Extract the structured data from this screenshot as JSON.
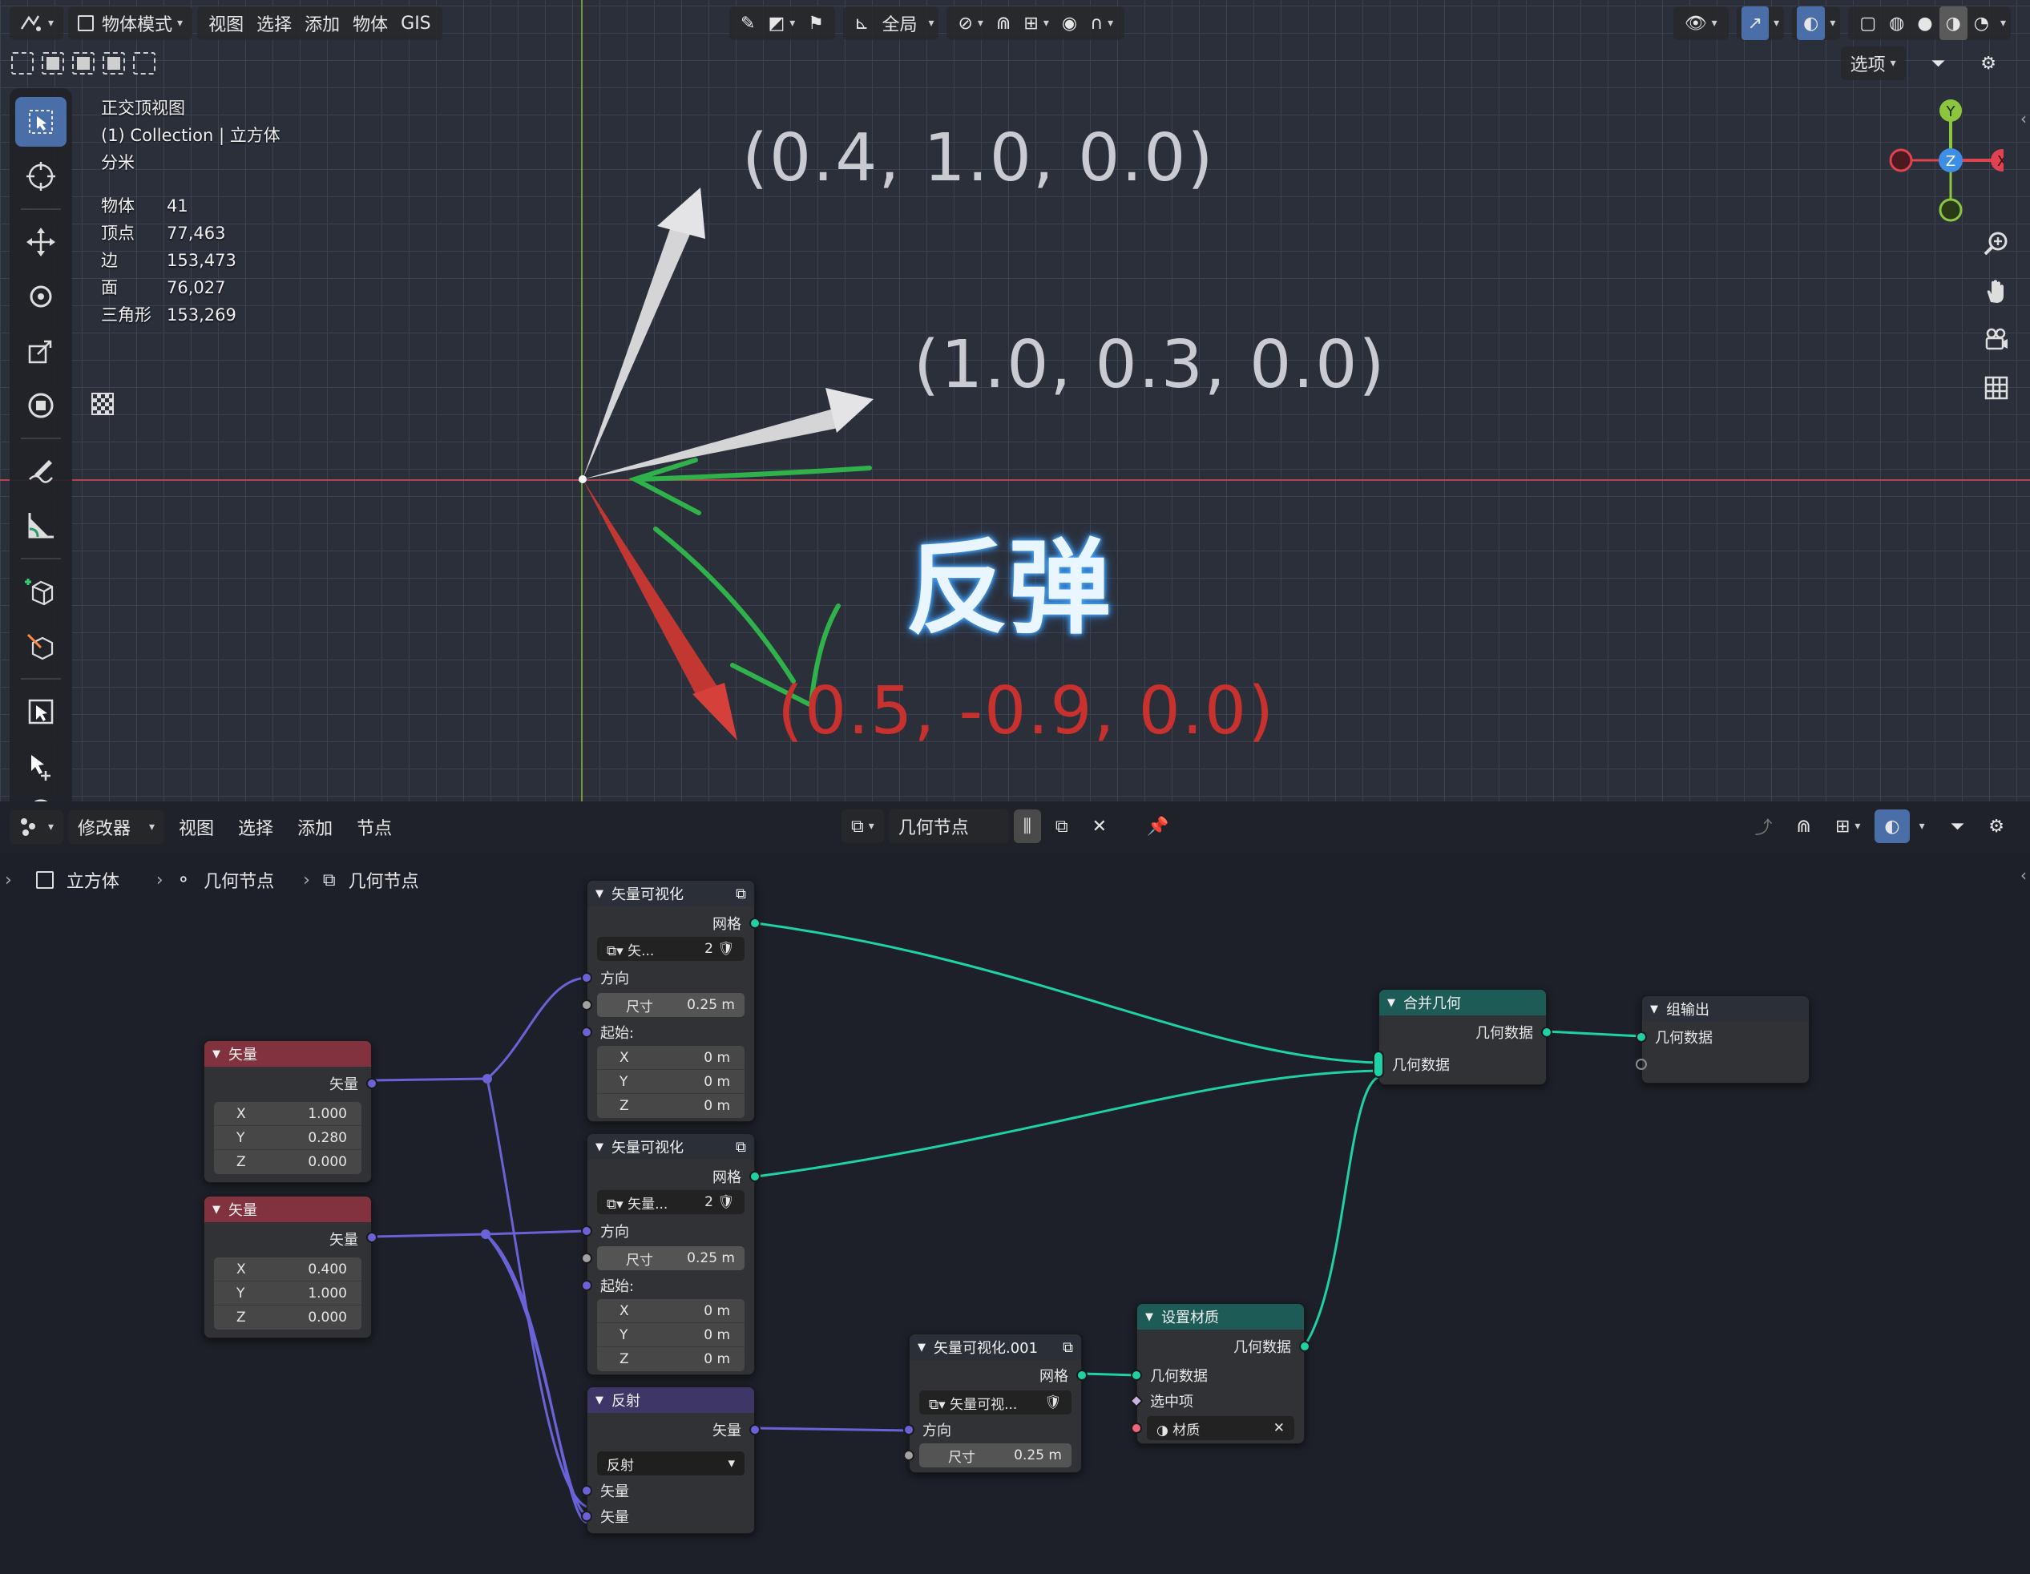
{
  "viewport": {
    "header": {
      "mode_label": "物体模式",
      "menus": [
        "视图",
        "选择",
        "添加",
        "物体",
        "GIS"
      ],
      "transform_orientation": "全局",
      "options_label": "选项"
    },
    "overlay": {
      "view_name": "正交顶视图",
      "collection_line": "(1) Collection | 立方体",
      "unit": "分米",
      "stats": [
        {
          "label": "物体",
          "value": "41"
        },
        {
          "label": "顶点",
          "value": "77,463"
        },
        {
          "label": "边",
          "value": "153,473"
        },
        {
          "label": "面",
          "value": "76,027"
        },
        {
          "label": "三角形",
          "value": "153,269"
        }
      ]
    },
    "gizmo": {
      "y": "Y",
      "x": "X",
      "z": "Z"
    },
    "annotations": {
      "vector_a": "(0.4, 1.0, 0.0)",
      "vector_b": "(1.0, 0.3, 0.0)",
      "vector_reflected": "(0.5, -0.9, 0.0)",
      "bounce": "反弹"
    },
    "colors": {
      "grid_bg": "#2b2f3a",
      "x_axis": "#b24650",
      "y_axis": "#6e9a3a",
      "reflect": "#c8312e",
      "annotation_green": "#2fb24a"
    }
  },
  "node_editor": {
    "header": {
      "editor_type": "修改器",
      "menus": [
        "视图",
        "选择",
        "添加",
        "节点"
      ],
      "tree_name": "几何节点"
    },
    "breadcrumb": [
      "立方体",
      "几何节点",
      "几何节点"
    ],
    "nodes": {
      "vector1": {
        "title": "矢量",
        "output": "矢量",
        "x": "1.000",
        "y": "0.280",
        "z": "0.000",
        "lx": "X",
        "ly": "Y",
        "lz": "Z"
      },
      "vector2": {
        "title": "矢量",
        "output": "矢量",
        "x": "0.400",
        "y": "1.000",
        "z": "0.000",
        "lx": "X",
        "ly": "Y",
        "lz": "Z"
      },
      "vis1": {
        "title": "矢量可视化",
        "output": "网格",
        "group": "矢...",
        "users": "2",
        "direction": "方向",
        "size_label": "尺寸",
        "size": "0.25 m",
        "start": "起始:",
        "sx": "0 m",
        "sy": "0 m",
        "sz": "0 m",
        "lx": "X",
        "ly": "Y",
        "lz": "Z"
      },
      "vis2": {
        "title": "矢量可视化",
        "output": "网格",
        "group": "矢量...",
        "users": "2",
        "direction": "方向",
        "size_label": "尺寸",
        "size": "0.25 m",
        "start": "起始:",
        "sx": "0 m",
        "sy": "0 m",
        "sz": "0 m",
        "lx": "X",
        "ly": "Y",
        "lz": "Z"
      },
      "reflect": {
        "title": "反射",
        "output": "矢量",
        "mode": "反射",
        "in1": "矢量",
        "in2": "矢量"
      },
      "vis3": {
        "title": "矢量可视化.001",
        "output": "网格",
        "group": "矢量可视...",
        "direction": "方向",
        "size_label": "尺寸",
        "size": "0.25 m"
      },
      "setmat": {
        "title": "设置材质",
        "output": "几何数据",
        "in_geo": "几何数据",
        "in_sel": "选中项",
        "in_mat": "材质"
      },
      "join": {
        "title": "合并几何",
        "output": "几何数据",
        "input": "几何数据"
      },
      "groupout": {
        "title": "组输出",
        "input": "几何数据"
      }
    }
  }
}
